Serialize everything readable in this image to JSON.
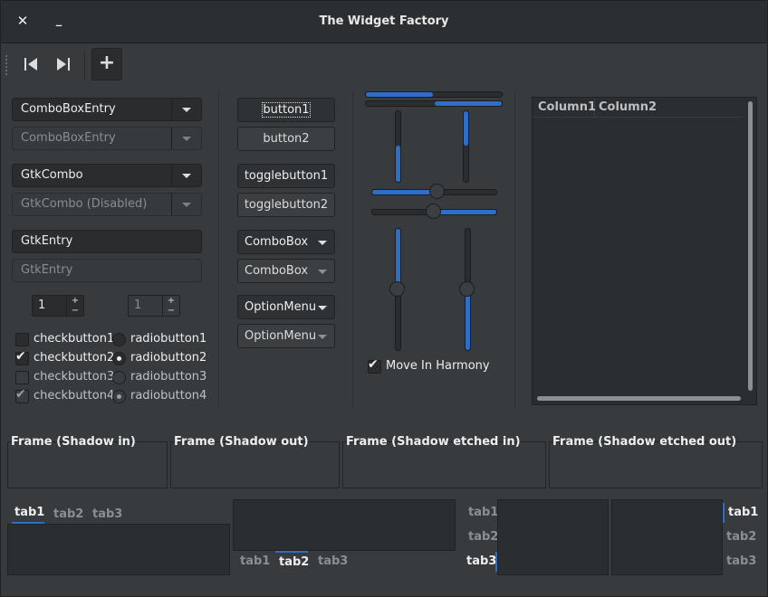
{
  "window": {
    "title": "The Widget Factory",
    "close_glyph": "✕",
    "minimize_glyph": "_"
  },
  "toolbar": {
    "icons": [
      "go-first-icon",
      "go-last-icon",
      "add-icon"
    ],
    "first_glyph": "⏮",
    "last_glyph": "⏭",
    "add_glyph": "+"
  },
  "left": {
    "combo_entry": "ComboBoxEntry",
    "combo_entry_disabled": "ComboBoxEntry",
    "gtk_combo": "GtkCombo",
    "gtk_combo_disabled": "GtkCombo (Disabled)",
    "entry": "GtkEntry",
    "entry_disabled": "GtkEntry",
    "spin1": "1",
    "spin2": "1",
    "plus": "+",
    "minus": "−",
    "checks": [
      {
        "label": "checkbutton1",
        "checked": false,
        "disabled": false
      },
      {
        "label": "checkbutton2",
        "checked": true,
        "disabled": false
      },
      {
        "label": "checkbutton3",
        "checked": false,
        "disabled": true
      },
      {
        "label": "checkbutton4",
        "checked": true,
        "disabled": true
      }
    ],
    "radios": [
      {
        "label": "radiobutton1",
        "selected": false,
        "disabled": false
      },
      {
        "label": "radiobutton2",
        "selected": true,
        "disabled": false
      },
      {
        "label": "radiobutton3",
        "selected": false,
        "disabled": true
      },
      {
        "label": "radiobutton4",
        "selected": true,
        "disabled": true
      }
    ],
    "check_mark": "✔"
  },
  "middle": {
    "button1": "button1",
    "button2": "button2",
    "toggle1": "togglebutton1",
    "toggle2": "togglebutton2",
    "combobox": "ComboBox",
    "combobox_disabled": "ComboBox",
    "optionmenu": "OptionMenu",
    "optionmenu_disabled": "OptionMenu"
  },
  "sliders": {
    "progress_top": 0.5,
    "progress_bottom": 0.5,
    "harmony_label": "Move In Harmony",
    "harmony_checked": true
  },
  "tree": {
    "columns": [
      "Column1",
      "Column2"
    ]
  },
  "frames": [
    "Frame (Shadow in)",
    "Frame (Shadow out)",
    "Frame (Shadow etched in)",
    "Frame (Shadow etched out)"
  ],
  "notebooks": {
    "tabs": [
      "tab1",
      "tab2",
      "tab3"
    ]
  },
  "colors": {
    "accent": "#2f6ec8",
    "background": "#383b3d",
    "titlebar": "#2c2f31"
  }
}
